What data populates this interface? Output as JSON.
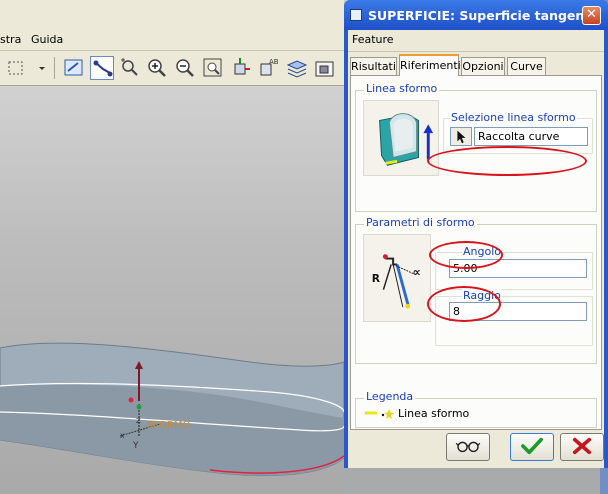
{
  "app": {
    "menu": [
      "stra",
      "Guida"
    ]
  },
  "viewport": {
    "annotation": "SFORMO",
    "axis_label": "Y"
  },
  "dialog": {
    "title": "SUPERFICIE: Superficie tangente",
    "close_glyph": "✕",
    "menu_feature": "Feature",
    "tabs": [
      {
        "label": "Risultati",
        "active": false
      },
      {
        "label": "Riferimenti",
        "active": true
      },
      {
        "label": "Opzioni",
        "active": false
      },
      {
        "label": "Curve",
        "active": false
      }
    ],
    "linea_sformo": {
      "group_label": "Linea sformo",
      "selection_label": "Selezione linea sformo",
      "selection_value": "Raccolta curve"
    },
    "parametri": {
      "group_label": "Parametri di sformo",
      "angolo_label": "Angolo",
      "angolo_value": "5.00",
      "raggio_label": "Raggio",
      "raggio_value": "8",
      "diagram_r": "R",
      "diagram_alpha": "∝"
    },
    "legenda": {
      "group_label": "Legenda",
      "item": "Linea sformo"
    },
    "buttons": {
      "preview_icon": "glasses-icon",
      "ok_icon": "checkmark-icon",
      "cancel_icon": "x-icon"
    },
    "colors": {
      "title_bar": "#2557d6",
      "label_blue": "#1a40b8",
      "highlight_red": "#d8141c",
      "ok_green": "#1e9a2a",
      "cancel_red": "#c8141c"
    }
  }
}
